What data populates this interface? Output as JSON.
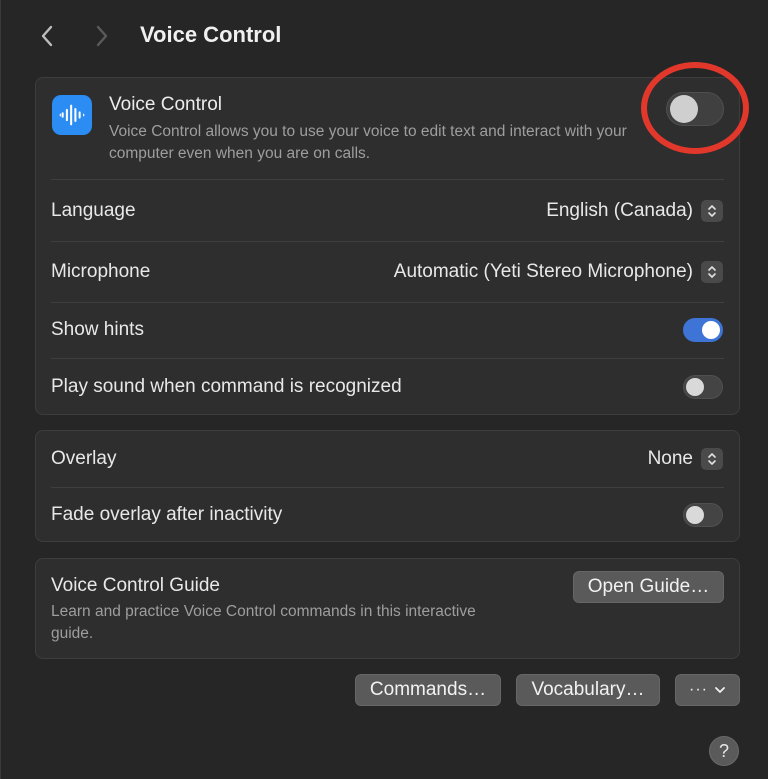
{
  "header": {
    "title": "Voice Control",
    "back_icon": "chevron-left-icon",
    "forward_icon": "chevron-right-icon"
  },
  "voice_control": {
    "title": "Voice Control",
    "description": "Voice Control allows you to use your voice to edit text and interact with your computer even when you are on calls.",
    "enabled": false,
    "icon": "waveform-icon"
  },
  "settings": {
    "language_label": "Language",
    "language_value": "English (Canada)",
    "microphone_label": "Microphone",
    "microphone_value": "Automatic (Yeti Stereo Microphone)",
    "show_hints_label": "Show hints",
    "show_hints_enabled": true,
    "play_sound_label": "Play sound when command is recognized",
    "play_sound_enabled": false
  },
  "overlay": {
    "overlay_label": "Overlay",
    "overlay_value": "None",
    "fade_label": "Fade overlay after inactivity",
    "fade_enabled": false
  },
  "guide": {
    "title": "Voice Control Guide",
    "description": "Learn and practice Voice Control commands in this interactive guide.",
    "button_label": "Open Guide…"
  },
  "footer": {
    "commands_label": "Commands…",
    "vocabulary_label": "Vocabulary…",
    "more_label": "···",
    "help_label": "?"
  },
  "colors": {
    "accent": "#3e74d6",
    "annotation": "#e2382b",
    "icon_bg": "#2b8cf4"
  }
}
